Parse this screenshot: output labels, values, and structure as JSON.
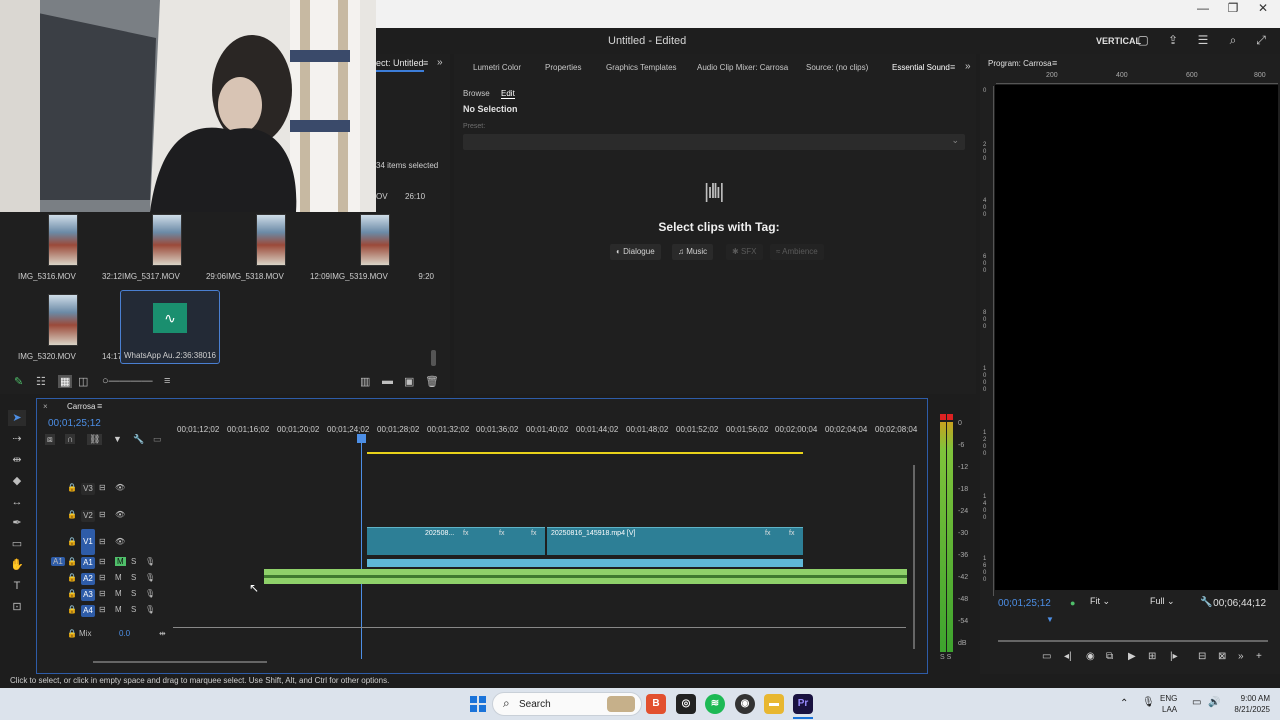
{
  "window": {
    "title": "Untitled - Edited",
    "layout_label": "VERTICAL"
  },
  "project": {
    "tab_title": "ect: Untitled",
    "items_selected": "34 items selected",
    "partial_dur": "26:10",
    "partial_name": "OV",
    "items": [
      {
        "name": "IMG_5316.MOV",
        "duration": "32:12"
      },
      {
        "name": "IMG_5317.MOV",
        "duration": "29:06"
      },
      {
        "name": "IMG_5318.MOV",
        "duration": "12:09"
      },
      {
        "name": "IMG_5319.MOV",
        "duration": "9:20"
      },
      {
        "name": "IMG_5320.MOV",
        "duration": "14:17"
      },
      {
        "name": "WhatsApp Au...",
        "duration": "2:36:38016"
      }
    ]
  },
  "essential": {
    "tabs": [
      "Lumetri Color",
      "Properties",
      "Graphics Templates",
      "Audio Clip Mixer: Carrosa",
      "Source: (no clips)",
      "Essential Sound"
    ],
    "subtabs": [
      "Browse",
      "Edit"
    ],
    "no_selection": "No Selection",
    "preset_label": "Preset:",
    "select_clips": "Select clips with Tag:",
    "tags": [
      "Dialogue",
      "Music",
      "SFX",
      "Ambience"
    ]
  },
  "program": {
    "title": "Program: Carrosa",
    "ruler": [
      "200",
      "400",
      "600",
      "800"
    ],
    "left_ruler": [
      "0",
      "2\n0\n0",
      "4\n0\n0",
      "6\n0\n0",
      "8\n0\n0",
      "1\n0\n0\n0",
      "1\n2\n0\n0",
      "1\n4\n0\n0",
      "1\n6\n0\n0"
    ],
    "timecode": "00;01;25;12",
    "fit": "Fit",
    "quality": "Full",
    "duration": "00;06;44;12"
  },
  "timeline": {
    "tab": "Carrosa",
    "timecode": "00;01;25;12",
    "ruler": [
      "00;01;12;02",
      "00;01;16;02",
      "00;01;20;02",
      "00;01;24;02",
      "00;01;28;02",
      "00;01;32;02",
      "00;01;36;02",
      "00;01;40;02",
      "00;01;44;02",
      "00;01;48;02",
      "00;01;52;02",
      "00;01;56;02",
      "00;02;00;04",
      "00;02;04;04",
      "00;02;08;04"
    ],
    "video_tracks": [
      "V3",
      "V2",
      "V1"
    ],
    "audio_tracks": [
      "A1",
      "A2",
      "A3",
      "A4"
    ],
    "source_patch": "A1",
    "mix_label": "Mix",
    "mix_value": "0.0",
    "clips": {
      "clip1": "202508...",
      "clip2": "20250816_145918.mp4 [V]",
      "fx": "fx"
    }
  },
  "meter": {
    "scale": [
      "0",
      "-6",
      "-12",
      "-18",
      "-24",
      "-30",
      "-36",
      "-42",
      "-48",
      "-54",
      "dB"
    ],
    "bottom": "S S"
  },
  "status": "Click to select, or click in empty space and drag to marquee select. Use Shift, Alt, and Ctrl for other options.",
  "taskbar": {
    "search": "Search",
    "lang": "ENG",
    "lang2": "LAA",
    "time": "9:00 AM",
    "date": "8/21/2025"
  },
  "colors": {
    "accent": "#4d8fe6",
    "video_clip": "#2d7f96",
    "audio_clip": "#8fd16a",
    "yellow_bar": "#e8d21a"
  }
}
